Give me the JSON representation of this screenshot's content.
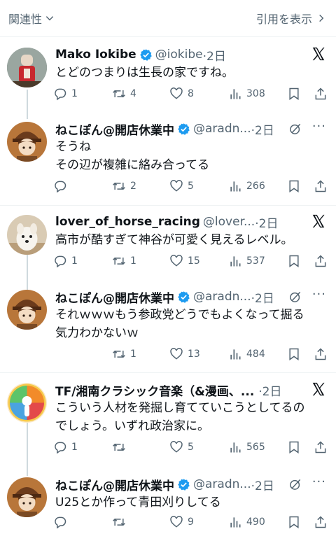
{
  "header": {
    "sort_label": "関連性",
    "quotes_label": "引用を表示"
  },
  "posts": [
    {
      "name": "Mako Iokibe",
      "verified": true,
      "handle": "@iokibe",
      "time": "·2日",
      "lines": [
        "とどのつまりは生長の家ですね。"
      ],
      "replies": "1",
      "reposts": "4",
      "likes": "8",
      "views": "308",
      "avatar": "red-figure",
      "corner": "x-logo"
    },
    {
      "name": "ねこぽん@開店休業中",
      "verified": true,
      "handle": "@aradn...",
      "time": "·2日",
      "lines": [
        "そうね",
        "その辺が複雑に絡み合ってる"
      ],
      "replies": "",
      "reposts": "2",
      "likes": "5",
      "views": "266",
      "avatar": "detective",
      "corner": "more"
    },
    {
      "name": "lover_of_horse_racing",
      "verified": false,
      "handle": "@lover...",
      "time": "·2日",
      "lines": [
        "高市が酷すぎて神谷が可愛く見えるレベル。"
      ],
      "replies": "1",
      "reposts": "1",
      "likes": "15",
      "views": "537",
      "avatar": "dog",
      "corner": "x-logo"
    },
    {
      "name": "ねこぽん@開店休業中",
      "verified": true,
      "handle": "@aradn...",
      "time": "·2日",
      "lines": [
        "それｗｗｗもう参政党どうでもよくなって掘る",
        "気力わかないｗ"
      ],
      "replies": "",
      "reposts": "1",
      "likes": "13",
      "views": "484",
      "avatar": "detective",
      "corner": "more"
    },
    {
      "name": "TF/湘南クラシック音楽（&漫画、...",
      "verified": false,
      "handle": "",
      "time": "·2日",
      "lines": [
        "こういう人材を発掘し育てていこうとしてるの",
        "でしょう。いずれ政治家に。"
      ],
      "replies": "1",
      "reposts": "",
      "likes": "5",
      "views": "565",
      "avatar": "rainbow",
      "corner": "x-logo"
    },
    {
      "name": "ねこぽん@開店休業中",
      "verified": true,
      "handle": "@aradn...",
      "time": "·2日",
      "lines": [
        "U25とか作って青田刈りしてる"
      ],
      "replies": "",
      "reposts": "",
      "likes": "9",
      "views": "490",
      "avatar": "detective",
      "corner": "more"
    }
  ],
  "colors": {
    "text": "#0f1419",
    "secondary": "#536471",
    "verified_blue": "#1d9bf0",
    "divider": "#eff3f4",
    "thread_line": "#cfd9de"
  }
}
